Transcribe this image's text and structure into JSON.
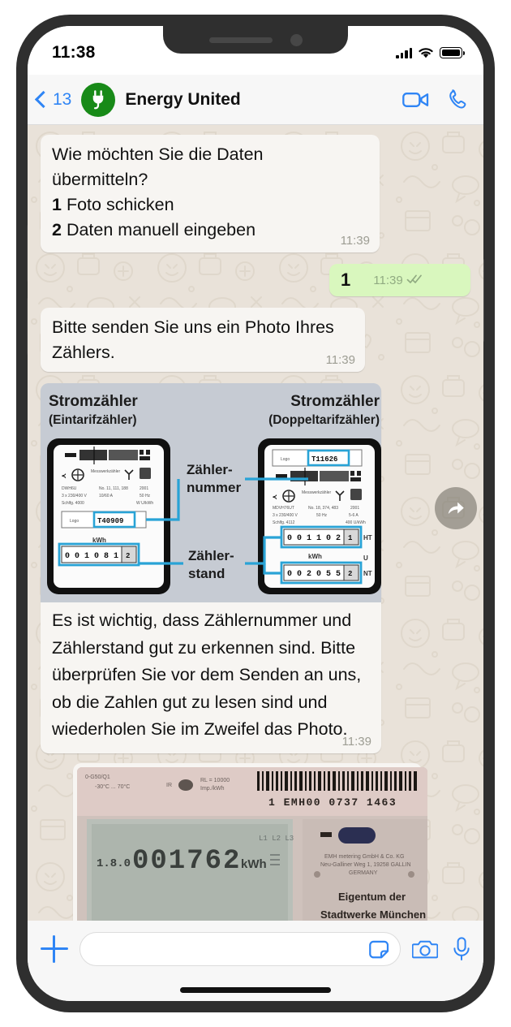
{
  "status_bar": {
    "time": "11:38",
    "signal_icon": "cellular-signal-icon",
    "wifi_icon": "wifi-icon",
    "battery_icon": "battery-full-icon"
  },
  "chat_header": {
    "back_count": "13",
    "back_icon": "chevron-left-icon",
    "avatar_icon": "power-plug-icon",
    "title": "Energy United",
    "video_call_icon": "video-camera-icon",
    "voice_call_icon": "phone-icon",
    "accent_color": "#2f85f5",
    "avatar_color": "#188a18"
  },
  "messages": [
    {
      "id": "msg-options",
      "direction": "incoming",
      "text_line1": "Wie möchten Sie die Daten",
      "text_line2": "übermitteln?",
      "option1_num": "1",
      "option1_label": "Foto schicken",
      "option2_num": "2",
      "option2_label": "Daten manuell eingeben",
      "time": "11:39"
    },
    {
      "id": "msg-reply-one",
      "direction": "outgoing",
      "text": "1",
      "time": "11:39",
      "status_icon": "double-check-icon"
    },
    {
      "id": "msg-request-photo",
      "direction": "incoming",
      "text": "Bitte senden Sie uns ein Photo Ihres Zählers.",
      "time": "11:39"
    },
    {
      "id": "msg-diagram",
      "direction": "incoming",
      "image_name": "meter-types-diagram",
      "caption": "Es ist wichtig, dass Zählernummer und Zählerstand gut zu erkennen sind. Bitte überprüfen Sie vor dem Senden an uns, ob die Zahlen gut zu lesen sind und wiederholen Sie im Zweifel das Photo.",
      "time": "11:39",
      "forward_icon": "forward-arrow-icon"
    },
    {
      "id": "msg-meter-photo",
      "direction": "incoming",
      "image_name": "electric-meter-photo"
    }
  ],
  "diagram": {
    "left_title": "Stromzähler",
    "left_subtitle": "(Eintarifzähler)",
    "right_title": "Stromzähler",
    "right_subtitle": "(Doppeltarifzähler)",
    "label_number_line1": "Zähler-",
    "label_number_line2": "nummer",
    "label_reading_line1": "Zähler-",
    "label_reading_line2": "stand",
    "left_meter_number": "T40909",
    "right_meter_number": "T11626",
    "left_reading": "0 0 1 0 8 1 2",
    "right_reading_ht": "0 0 1 1 0 2 1",
    "right_reading_nt": "0 0 2 0 5 5 2",
    "unit": "kWh",
    "tariff_high": "HT",
    "tariff_low": "NT",
    "highlight_color": "#29a3d6",
    "panel_color": "#c6cbd3"
  },
  "meter_photo": {
    "model_code": "0-G50/Q1",
    "temp_range": "-30°C ... 70°C",
    "ir_label": "IR",
    "pulse_line1": "RL = 10000",
    "pulse_line2": "Imp./kWh",
    "serial": "1 EMH00 0737 1463",
    "lcd_prefix": "1.8.0",
    "lcd_value": "001762",
    "lcd_unit": "kWh",
    "lcd_phases": "L1 L2 L3",
    "manufacturer_line1": "EMH metering GmbH & Co. KG",
    "manufacturer_line2": "Neu-Galliner Weg 1, 19258 GALLIN",
    "manufacturer_line3": "GERMANY",
    "ownership_line1": "Eigentum der",
    "ownership_line2": "Stadtwerke München GmbH"
  },
  "input_bar": {
    "plus_icon": "plus-icon",
    "message_value": "",
    "message_placeholder": "",
    "sticker_icon": "sticker-icon",
    "camera_icon": "camera-icon",
    "mic_icon": "microphone-icon"
  },
  "theme": {
    "chat_background": "#e9e2d9",
    "incoming_bubble": "#f7f5f2",
    "outgoing_bubble": "#d9f7be",
    "header_background": "#f7f7f7",
    "frame_color": "#2f2f2f"
  }
}
